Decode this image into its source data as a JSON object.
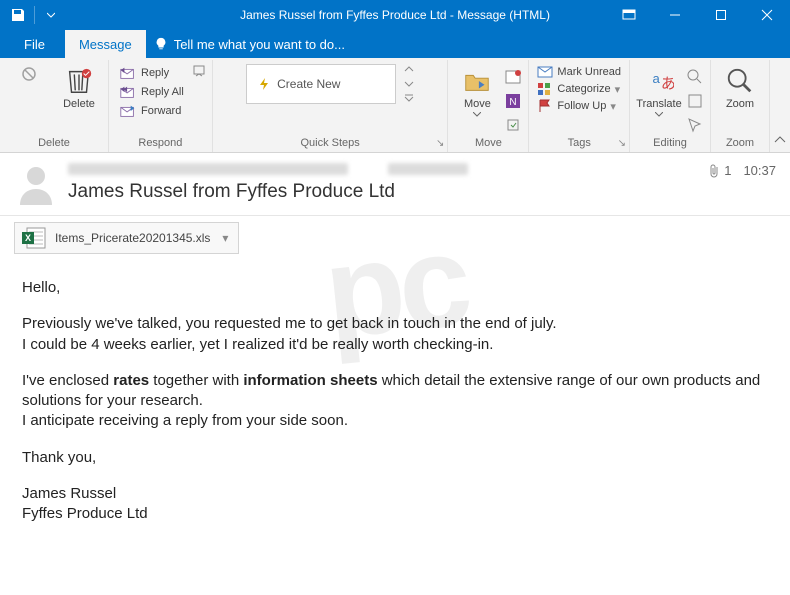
{
  "window": {
    "title": "James Russel from Fyffes Produce Ltd - Message (HTML)"
  },
  "tabs": {
    "file": "File",
    "message": "Message",
    "tell_me": "Tell me what you want to do..."
  },
  "ribbon": {
    "delete": {
      "label": "Delete",
      "group": "Delete"
    },
    "respond": {
      "reply": "Reply",
      "reply_all": "Reply All",
      "forward": "Forward",
      "group": "Respond"
    },
    "quick_steps": {
      "create_new": "Create New",
      "group": "Quick Steps"
    },
    "move": {
      "label": "Move",
      "group": "Move"
    },
    "tags": {
      "mark_unread": "Mark Unread",
      "categorize": "Categorize",
      "follow_up": "Follow Up",
      "group": "Tags"
    },
    "editing": {
      "translate": "Translate",
      "group": "Editing"
    },
    "zoom": {
      "label": "Zoom",
      "group": "Zoom"
    }
  },
  "message": {
    "subject": "James Russel from Fyffes Produce Ltd",
    "attachment_count": "1",
    "time": "10:37",
    "attachment_name": "Items_Pricerate20201345.xls",
    "body": {
      "p1": "Hello,",
      "p2a": "Previously we've talked, you requested me to get back in touch in the end of july.",
      "p2b": "I could be 4 weeks earlier, yet I realized it'd be really worth checking-in.",
      "p3a_pre": "I've enclosed ",
      "p3a_b1": "rates",
      "p3a_mid": " together with ",
      "p3a_b2": "information sheets",
      "p3a_post": " which detail the extensive range of our own products and solutions for your research.",
      "p3b": "I anticipate receiving a reply from your side soon.",
      "p4": "Thank you,",
      "sig1": "James Russel",
      "sig2": "Fyffes Produce Ltd"
    }
  }
}
